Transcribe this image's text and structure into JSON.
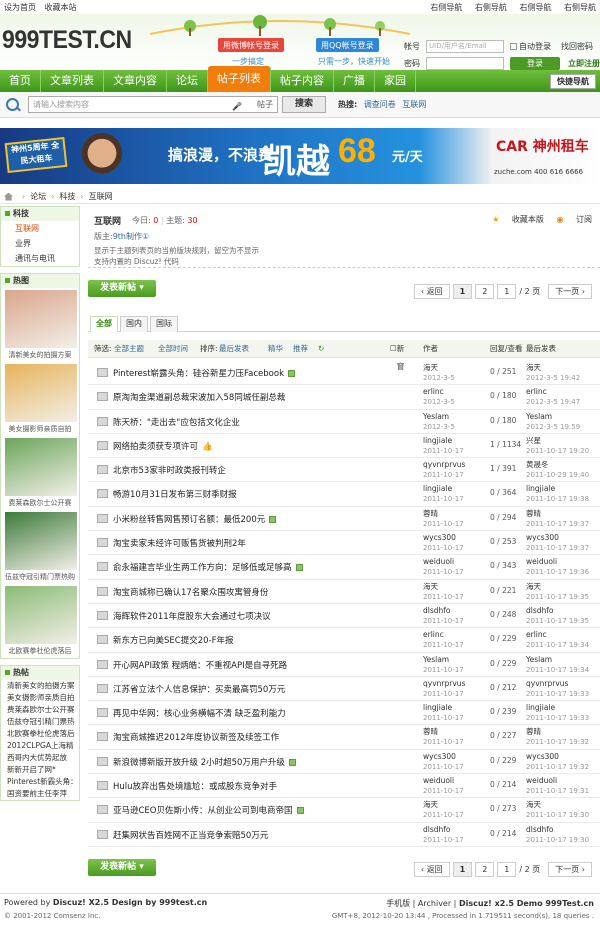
{
  "topbar": {
    "left": [
      "设为首页",
      "收藏本站"
    ],
    "right": [
      "右侧导航",
      "右侧导航",
      "右侧导航",
      "右侧导航"
    ]
  },
  "header": {
    "logo": "999TEST.CN",
    "login_weibo": "用微博帐号登录",
    "login_qq": "用QQ帐号登录",
    "weibo_sub": "一步搞定",
    "qq_sub": "只需一步，快速开始",
    "account_label": "帐号",
    "account_placeholder": "UID/用户名/Email",
    "auto_login": "自动登录",
    "find_pwd": "找回密码",
    "pwd_label": "密码",
    "login_btn": "登录",
    "register": "立即注册"
  },
  "nav": {
    "items": [
      "首页",
      "文章列表",
      "文章内容",
      "论坛",
      "帖子列表",
      "帖子内容",
      "广播",
      "家园"
    ],
    "active_index": 4,
    "quick_nav": "快捷导航"
  },
  "search": {
    "placeholder": "请输入搜索内容",
    "category": "帖子",
    "button": "搜索",
    "hot_label": "热搜:",
    "hot": [
      "调查问卷",
      "互联网"
    ]
  },
  "banner": {
    "tag": "神州5周年 全民大租车",
    "slogan": "搞浪漫，不浪费",
    "big": "凯越",
    "num": "68",
    "unit": "元/天",
    "brand": "CAR 神州租车",
    "site": "zuche.com  400 616 6666"
  },
  "breadcrumb": [
    "论坛",
    "科技",
    "互联网"
  ],
  "sidebar": {
    "cat_title": "科技",
    "cat_items": [
      "互联网",
      "业界",
      "通讯与电讯"
    ],
    "hot_title": "热图",
    "thumbs": [
      {
        "caption": "清新美女的拍摄方案",
        "color": "#d9a58b"
      },
      {
        "caption": "美女摄影师亲质自拍",
        "color": "#e6b35a"
      },
      {
        "caption": "费莱森欧尔士公开赛",
        "color": "#6aa55a"
      },
      {
        "caption": "伍兹夺冠引精门票热购",
        "color": "#3d7a3a"
      },
      {
        "caption": "北欧赛拳杜伦虎落后",
        "color": "#8bbb76"
      }
    ],
    "hot_posts_title": "热帖",
    "hot_posts": [
      "清新美女的拍摄方案",
      "美女摄影师亲质自拍",
      "费莱森欧尔士公开赛",
      "伍兹夺冠引精门票热",
      "北欧赛拳杜伦虎落后",
      "2012CLPGA上海精",
      "西哥内大优势起放",
      "新新开启了网*",
      "Pinterest新霸头角：",
      "国资要前主任李萍"
    ]
  },
  "forum": {
    "name": "互联网",
    "today_label": "今日:",
    "today": "0",
    "topics_label": "主题:",
    "topics": "30",
    "mod_label": "版主:",
    "mod": "9th制作①",
    "rule1": "显示于主题列表页的当前版块规则，留空为不显示",
    "rule2": "支持内置的 Discuz! 代码",
    "fav": "收藏本版",
    "rss": "订阅"
  },
  "new_post": "发表新帖",
  "pager": {
    "back": "返回",
    "p1": "1",
    "p2": "2",
    "input": "1",
    "total": "/ 2 页",
    "next": "下一页"
  },
  "tabs": [
    "全部",
    "国内",
    "国际"
  ],
  "filter": {
    "label": "筛选:",
    "all_topic": "全部主题",
    "all_time": "全部时间",
    "sort_label": "排序:",
    "sort": "最后发表",
    "digest": "精华",
    "recommend": "推荐",
    "new_window": "新窗",
    "author": "作者",
    "replies": "回复/查看",
    "last": "最后发表"
  },
  "threads": [
    {
      "title": "Pinterest崭露头角：硅谷新星力压Facebook",
      "att": true,
      "author": "海天",
      "date": "2012-3-5",
      "count": "0 / 251",
      "last": "海天",
      "last_time": "2012-3-5 19:42"
    },
    {
      "title": "原淘淘金渠道副总裁宋波加入58同城任副总裁",
      "author": "erlinc",
      "date": "2012-3-5",
      "count": "0 / 180",
      "last": "erlinc",
      "last_time": "2012-3-5 19:47"
    },
    {
      "title": "陈天桥：\"走出去\"应包括文化企业",
      "author": "Yeslam",
      "date": "2012-3-5",
      "count": "0 / 180",
      "last": "Yeslam",
      "last_time": "2012-3-5 19:59"
    },
    {
      "title": "网络拍卖须获专项许可",
      "thumb": true,
      "author": "lingjiale",
      "date": "2011-10-17",
      "count": "1 / 1134",
      "last": "兴星",
      "last_time": "2011-10-17 19:20"
    },
    {
      "title": "北京市53家非时政类报刊转企",
      "author": "qyvnrprvus",
      "date": "2011-10-17",
      "count": "1 / 391",
      "last": "黄晟冬",
      "last_time": "2011-10-29 19:40"
    },
    {
      "title": "畅游10月31日发布第三财季财报",
      "author": "lingjiale",
      "date": "2011-10-17",
      "count": "0 / 364",
      "last": "lingjiale",
      "last_time": "2011-10-17 19:38"
    },
    {
      "title": "小米粉丝转售网售预订名额：最低200元",
      "att": true,
      "author": "蓉晴",
      "date": "2011-10-17",
      "count": "0 / 294",
      "last": "蓉晴",
      "last_time": "2011-10-17 19:37"
    },
    {
      "title": "淘宝卖家未经许可贩售货被判刑2年",
      "author": "wycs300",
      "date": "2011-10-17",
      "count": "0 / 253",
      "last": "wycs300",
      "last_time": "2011-10-17 19:37"
    },
    {
      "title": "俞永福建言毕业生两工作方向：足够低或足够高",
      "att": true,
      "author": "weiduoli",
      "date": "2011-10-17",
      "count": "0 / 343",
      "last": "weiduoli",
      "last_time": "2011-10-17 19:36"
    },
    {
      "title": "淘宝商城称已确认17名聚众围攻寓管身份",
      "author": "海天",
      "date": "2011-10-17",
      "count": "0 / 221",
      "last": "海天",
      "last_time": "2011-10-17 19:35"
    },
    {
      "title": "海辉软件2011年度股东大会通过七项决议",
      "author": "dlsdhfo",
      "date": "2011-10-17",
      "count": "0 / 248",
      "last": "dlsdhfo",
      "last_time": "2011-10-17 19:35"
    },
    {
      "title": "新东方已向美SEC提交20-F年报",
      "author": "erlinc",
      "date": "2011-10-17",
      "count": "0 / 229",
      "last": "erlinc",
      "last_time": "2011-10-17 19:34"
    },
    {
      "title": "开心网API政策 程炳皓：不重视API是自寻死路",
      "author": "Yeslam",
      "date": "2011-10-17",
      "count": "0 / 229",
      "last": "Yeslam",
      "last_time": "2011-10-17 19:34"
    },
    {
      "title": "江苏省立法个人信息保护：买卖最高罚50万元",
      "author": "qyvnrprvus",
      "date": "2011-10-17",
      "count": "0 / 212",
      "last": "qyvnrprvus",
      "last_time": "2011-10-17 19:33"
    },
    {
      "title": "再见中华网：核心业务横幅不清 缺乏盈利能力",
      "author": "lingjiale",
      "date": "2011-10-17",
      "count": "0 / 239",
      "last": "lingjiale",
      "last_time": "2011-10-17 19:33"
    },
    {
      "title": "淘宝商城推迟2012年度协议新签及续签工作",
      "author": "蓉晴",
      "date": "2011-10-17",
      "count": "0 / 227",
      "last": "蓉晴",
      "last_time": "2011-10-17 19:32"
    },
    {
      "title": "新浪微博新版开放升级 2小时超50万用户升级",
      "att": true,
      "author": "wycs300",
      "date": "2011-10-17",
      "count": "0 / 229",
      "last": "wycs300",
      "last_time": "2011-10-17 19:32"
    },
    {
      "title": "Hulu放弃出售处境尴尬：或成股东竞争对手",
      "author": "weiduoli",
      "date": "2011-10-17",
      "count": "0 / 214",
      "last": "weiduoli",
      "last_time": "2011-10-17 19:31"
    },
    {
      "title": "亚马逊CEO贝佐斯小传：从创业公司到电商帝国",
      "att": true,
      "author": "海天",
      "date": "2011-10-17",
      "count": "0 / 273",
      "last": "海天",
      "last_time": "2011-10-17 19:30"
    },
    {
      "title": "赶集网状告百姓网不正当竞争索赔50万元",
      "author": "dlsdhfo",
      "date": "2011-10-17",
      "count": "0 / 214",
      "last": "dlsdhfo",
      "last_time": "2011-10-17 19:30"
    }
  ],
  "footer": {
    "powered_label": "Powered by",
    "powered": "Discuz! X2.5 Design by 999test.cn",
    "copyright": "© 2001-2012 Comsenz Inc.",
    "links": "手机版 | Archiver |",
    "demo": "Discuz! x2.5 Demo 999Test.cn",
    "stats": "GMT+8, 2012-10-20 13:44 , Processed in 1.719511 second(s), 18 queries ."
  }
}
